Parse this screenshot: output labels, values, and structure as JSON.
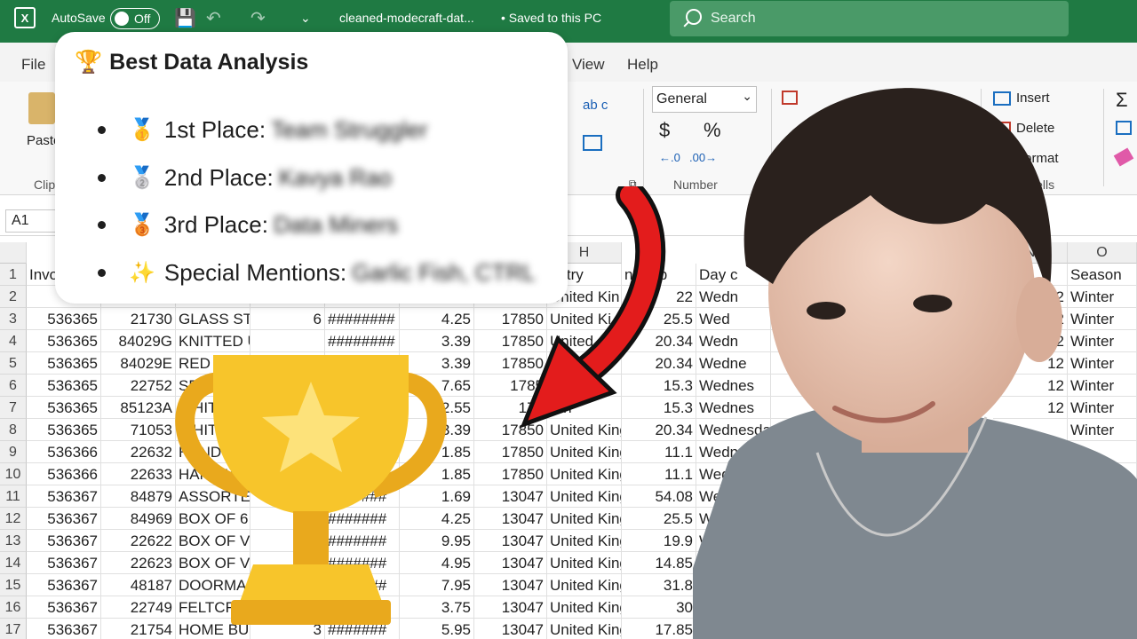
{
  "titlebar": {
    "excel_logo": "X",
    "autosave_label": "AutoSave",
    "autosave_state": "Off",
    "filename": "cleaned-modecraft-dat...",
    "save_status": "• Saved to this PC",
    "search_placeholder": "Search"
  },
  "menu": {
    "file": "File",
    "view": "View",
    "help": "Help"
  },
  "ribbon": {
    "paste": "Paste",
    "clipboard": "Clip",
    "number_format": "General",
    "currency": "$",
    "percent": "%",
    "number_group": "Number",
    "insert": "Insert",
    "delete": "Delete",
    "format": "Format",
    "cells_group": "Cells",
    "wrap_text": "ab c"
  },
  "formula_bar": {
    "name_box": "A1"
  },
  "grid": {
    "columns": [
      "H",
      "N",
      "O"
    ],
    "header_row": {
      "col_a": "Invo",
      "col_h": "untry",
      "col_i": "nue (p",
      "col_j": "Day c",
      "col_n": "nth",
      "col_o": "Season"
    },
    "row_numbers": [
      "1",
      "2",
      "3",
      "4",
      "5",
      "6",
      "7",
      "8",
      "9",
      "10",
      "11",
      "12",
      "13",
      "14",
      "15",
      "16",
      "17"
    ],
    "rows": [
      {
        "a": "53",
        "b": "",
        "c": "",
        "d": "",
        "e": "",
        "f": "",
        "g": "",
        "h": "United Kin",
        "i": "22",
        "j": "Wedn",
        "k": "",
        "n": "12",
        "o": "Winter"
      },
      {
        "a": "536365",
        "b": "21730",
        "c": "GLASS STA",
        "d": "6",
        "e": "########",
        "f": "4.25",
        "g": "17850",
        "h": "United Ki",
        "i": "25.5",
        "j": "Wed",
        "k": "",
        "n": "12",
        "o": "Winter"
      },
      {
        "a": "536365",
        "b": "84029G",
        "c": "KNITTED U",
        "d": "",
        "e": "########",
        "f": "3.39",
        "g": "17850",
        "h": "United",
        "i": "20.34",
        "j": "Wedn",
        "k": "",
        "n": "12",
        "o": "Winter"
      },
      {
        "a": "536365",
        "b": "84029E",
        "c": "RED W",
        "d": "",
        "e": "",
        "f": "3.39",
        "g": "17850",
        "h": "United K",
        "i": "20.34",
        "j": "Wedne",
        "k": "",
        "n": "12",
        "o": "Winter"
      },
      {
        "a": "536365",
        "b": "22752",
        "c": "SET 7",
        "d": "",
        "e": "",
        "f": "7.65",
        "g": "1785",
        "h": "Kin",
        "i": "15.3",
        "j": "Wednes",
        "k": "",
        "n": "12",
        "o": "Winter"
      },
      {
        "a": "536365",
        "b": "85123A",
        "c": "WHITE",
        "d": "",
        "e": "",
        "f": "2.55",
        "g": "178",
        "h": "Kin",
        "i": "15.3",
        "j": "Wednes",
        "k": "",
        "n": "12",
        "o": "Winter"
      },
      {
        "a": "536365",
        "b": "71053",
        "c": "WHITE",
        "d": "",
        "e": "",
        "f": "3.39",
        "g": "17850",
        "h": "United King",
        "i": "20.34",
        "j": "Wednesda",
        "k": "Morning",
        "n": "",
        "o": "Winter"
      },
      {
        "a": "536366",
        "b": "22632",
        "c": "HAND",
        "d": "",
        "e": "",
        "f": "1.85",
        "g": "17850",
        "h": "United King",
        "i": "11.1",
        "j": "Wednesda",
        "k": "Morning",
        "n": "",
        "o": ""
      },
      {
        "a": "536366",
        "b": "22633",
        "c": "HAND WA",
        "d": "",
        "e": "##",
        "f": "1.85",
        "g": "17850",
        "h": "United King",
        "i": "11.1",
        "j": "Wednesda",
        "k": "Morning",
        "n": "",
        "o": ""
      },
      {
        "a": "536367",
        "b": "84879",
        "c": "ASSORTED",
        "d": "",
        "e": "#######",
        "f": "1.69",
        "g": "13047",
        "h": "United King",
        "i": "54.08",
        "j": "Wednesda",
        "k": "Mornin",
        "n": "",
        "o": ""
      },
      {
        "a": "536367",
        "b": "84969",
        "c": "BOX OF 6 A",
        "d": "",
        "e": "#######",
        "f": "4.25",
        "g": "13047",
        "h": "United King",
        "i": "25.5",
        "j": "Wednesda",
        "k": "Mo",
        "n": "",
        "o": ""
      },
      {
        "a": "536367",
        "b": "22622",
        "c": "BOX OF VI",
        "d": "",
        "e": "#######",
        "f": "9.95",
        "g": "13047",
        "h": "United King",
        "i": "19.9",
        "j": "Wednesda",
        "k": "",
        "n": "",
        "o": ""
      },
      {
        "a": "536367",
        "b": "22623",
        "c": "BOX OF VI",
        "d": "",
        "e": "#######",
        "f": "4.95",
        "g": "13047",
        "h": "United King",
        "i": "14.85",
        "j": "Wedne",
        "k": "",
        "n": "",
        "o": ""
      },
      {
        "a": "536367",
        "b": "48187",
        "c": "DOORMA",
        "d": "",
        "e": "#######",
        "f": "7.95",
        "g": "13047",
        "h": "United King",
        "i": "31.8",
        "j": "We",
        "k": "",
        "n": "",
        "o": ""
      },
      {
        "a": "536367",
        "b": "22749",
        "c": "FELTCR",
        "d": "",
        "e": "#######",
        "f": "3.75",
        "g": "13047",
        "h": "United King",
        "i": "30",
        "j": "",
        "k": "",
        "n": "",
        "o": ""
      },
      {
        "a": "536367",
        "b": "21754",
        "c": "HOME BUI",
        "d": "3",
        "e": "#######",
        "f": "5.95",
        "g": "13047",
        "h": "United King",
        "i": "17.85",
        "j": "",
        "k": "",
        "n": "",
        "o": ""
      }
    ]
  },
  "card": {
    "title_icon": "🏆",
    "title": "Best Data Analysis",
    "awards": [
      {
        "medal": "🥇",
        "label": "1st Place:",
        "value": "Team Struggler"
      },
      {
        "medal": "🥈",
        "label": "2nd Place:",
        "value": "Kavya Rao"
      },
      {
        "medal": "🥉",
        "label": "3rd Place:",
        "value": "Data Miners"
      },
      {
        "medal": "✨",
        "label": "Special Mentions:",
        "value": "Garlic Fish, CTRL"
      }
    ]
  },
  "colors": {
    "excel_green": "#1f7a43",
    "trophy_gold": "#f7c52b",
    "trophy_shade": "#e9a91d",
    "arrow_red": "#e31c1c"
  }
}
